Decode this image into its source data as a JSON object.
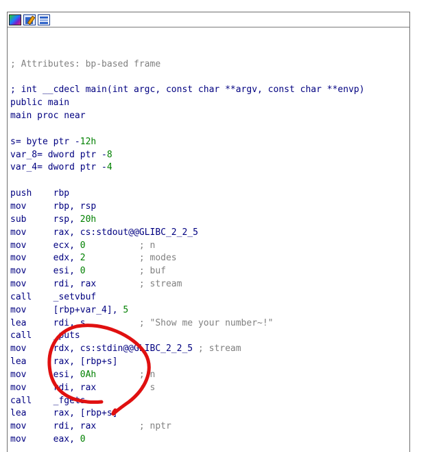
{
  "toolbar": {
    "buttons": [
      {
        "icon": "color-palette-icon"
      },
      {
        "icon": "edit-icon"
      },
      {
        "icon": "graph-view-icon"
      }
    ]
  },
  "listing": [
    [],
    [],
    [
      {
        "t": "; Attributes: bp-based frame",
        "c": "comment"
      }
    ],
    [],
    [
      {
        "t": "; int __cdecl main(int argc, const char **argv, const char **envp)",
        "c": "name"
      }
    ],
    [
      {
        "t": "public main",
        "c": "name"
      }
    ],
    [
      {
        "t": "main proc near",
        "c": "name"
      }
    ],
    [],
    [
      {
        "t": "s= byte ptr -",
        "c": "name"
      },
      {
        "t": "12h",
        "c": "num"
      }
    ],
    [
      {
        "t": "var_8= dword ptr -",
        "c": "name"
      },
      {
        "t": "8",
        "c": "num"
      }
    ],
    [
      {
        "t": "var_4= dword ptr -",
        "c": "name"
      },
      {
        "t": "4",
        "c": "num"
      }
    ],
    [],
    [
      {
        "t": "push    rbp",
        "c": "name"
      }
    ],
    [
      {
        "t": "mov     rbp, rsp",
        "c": "name"
      }
    ],
    [
      {
        "t": "sub     rsp, ",
        "c": "name"
      },
      {
        "t": "20h",
        "c": "num"
      }
    ],
    [
      {
        "t": "mov     rax, cs:stdout@@GLIBC_2_2_5",
        "c": "name"
      }
    ],
    [
      {
        "t": "mov     ecx, ",
        "c": "name"
      },
      {
        "t": "0",
        "c": "num"
      },
      {
        "t": "          ; n",
        "c": "comment"
      }
    ],
    [
      {
        "t": "mov     edx, ",
        "c": "name"
      },
      {
        "t": "2",
        "c": "num"
      },
      {
        "t": "          ; modes",
        "c": "comment"
      }
    ],
    [
      {
        "t": "mov     esi, ",
        "c": "name"
      },
      {
        "t": "0",
        "c": "num"
      },
      {
        "t": "          ; buf",
        "c": "comment"
      }
    ],
    [
      {
        "t": "mov     rdi, rax",
        "c": "name"
      },
      {
        "t": "        ; stream",
        "c": "comment"
      }
    ],
    [
      {
        "t": "call    _setvbuf",
        "c": "name"
      }
    ],
    [
      {
        "t": "mov     [rbp+var_4], ",
        "c": "name"
      },
      {
        "t": "5",
        "c": "num"
      }
    ],
    [
      {
        "t": "lea     rdi, s",
        "c": "name"
      },
      {
        "t": "          ; \"Show me your number~!\"",
        "c": "comment"
      }
    ],
    [
      {
        "t": "call    _puts",
        "c": "name"
      }
    ],
    [
      {
        "t": "mov     rdx, cs:stdin@@GLIBC_2_2_5",
        "c": "name"
      },
      {
        "t": " ; stream",
        "c": "comment"
      }
    ],
    [
      {
        "t": "lea     rax, [rbp+s]",
        "c": "name"
      }
    ],
    [
      {
        "t": "mov     esi, ",
        "c": "name"
      },
      {
        "t": "0Ah",
        "c": "num"
      },
      {
        "t": "        ; n",
        "c": "comment"
      }
    ],
    [
      {
        "t": "mov     rdi, rax",
        "c": "name"
      },
      {
        "t": "        ; s",
        "c": "comment"
      }
    ],
    [
      {
        "t": "call    _fgets",
        "c": "name"
      }
    ],
    [
      {
        "t": "lea     rax, [rbp+s]",
        "c": "name"
      }
    ],
    [
      {
        "t": "mov     rdi, rax",
        "c": "name"
      },
      {
        "t": "        ; nptr",
        "c": "comment"
      }
    ],
    [
      {
        "t": "mov     eax, ",
        "c": "name"
      },
      {
        "t": "0",
        "c": "num"
      }
    ]
  ],
  "annotation": {
    "color": "#e01010"
  }
}
